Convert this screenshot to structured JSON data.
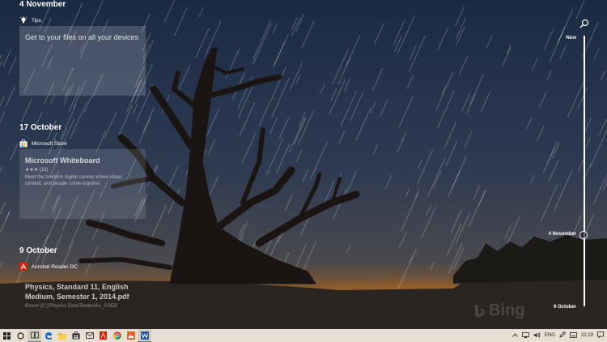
{
  "timeline": {
    "groups": [
      {
        "date": "4 November",
        "app": "Tips",
        "card_title": "Get to your files on all your devices"
      },
      {
        "date": "17 October",
        "app": "Microsoft Store",
        "card_title": "Microsoft Whiteboard",
        "card_meta": "★★★ (18)",
        "card_desc": "Meet the freeform digital canvas where ideas, content, and people come together."
      },
      {
        "date": "9 October",
        "app": "Acrobat Reader DC",
        "card_title": "Physics, Standard 11, English Medium, Semester 1, 2014.pdf",
        "card_desc": "Boson (C:)\\Physics Data\\Textbooks_GSEB"
      }
    ],
    "scrubber": {
      "top_label": "Now",
      "mid_label": "4 November",
      "bottom_label": "9 October"
    }
  },
  "watermark": "Bing",
  "taskbar": {
    "icons": [
      "windows-start-icon",
      "search-icon",
      "task-view-icon",
      "edge-icon",
      "explorer-icon",
      "store-icon",
      "mail-icon",
      "acrobat-icon",
      "chrome-icon",
      "photos-icon",
      "word-icon"
    ],
    "tray": {
      "language": "ENG",
      "time": "22:19"
    }
  }
}
